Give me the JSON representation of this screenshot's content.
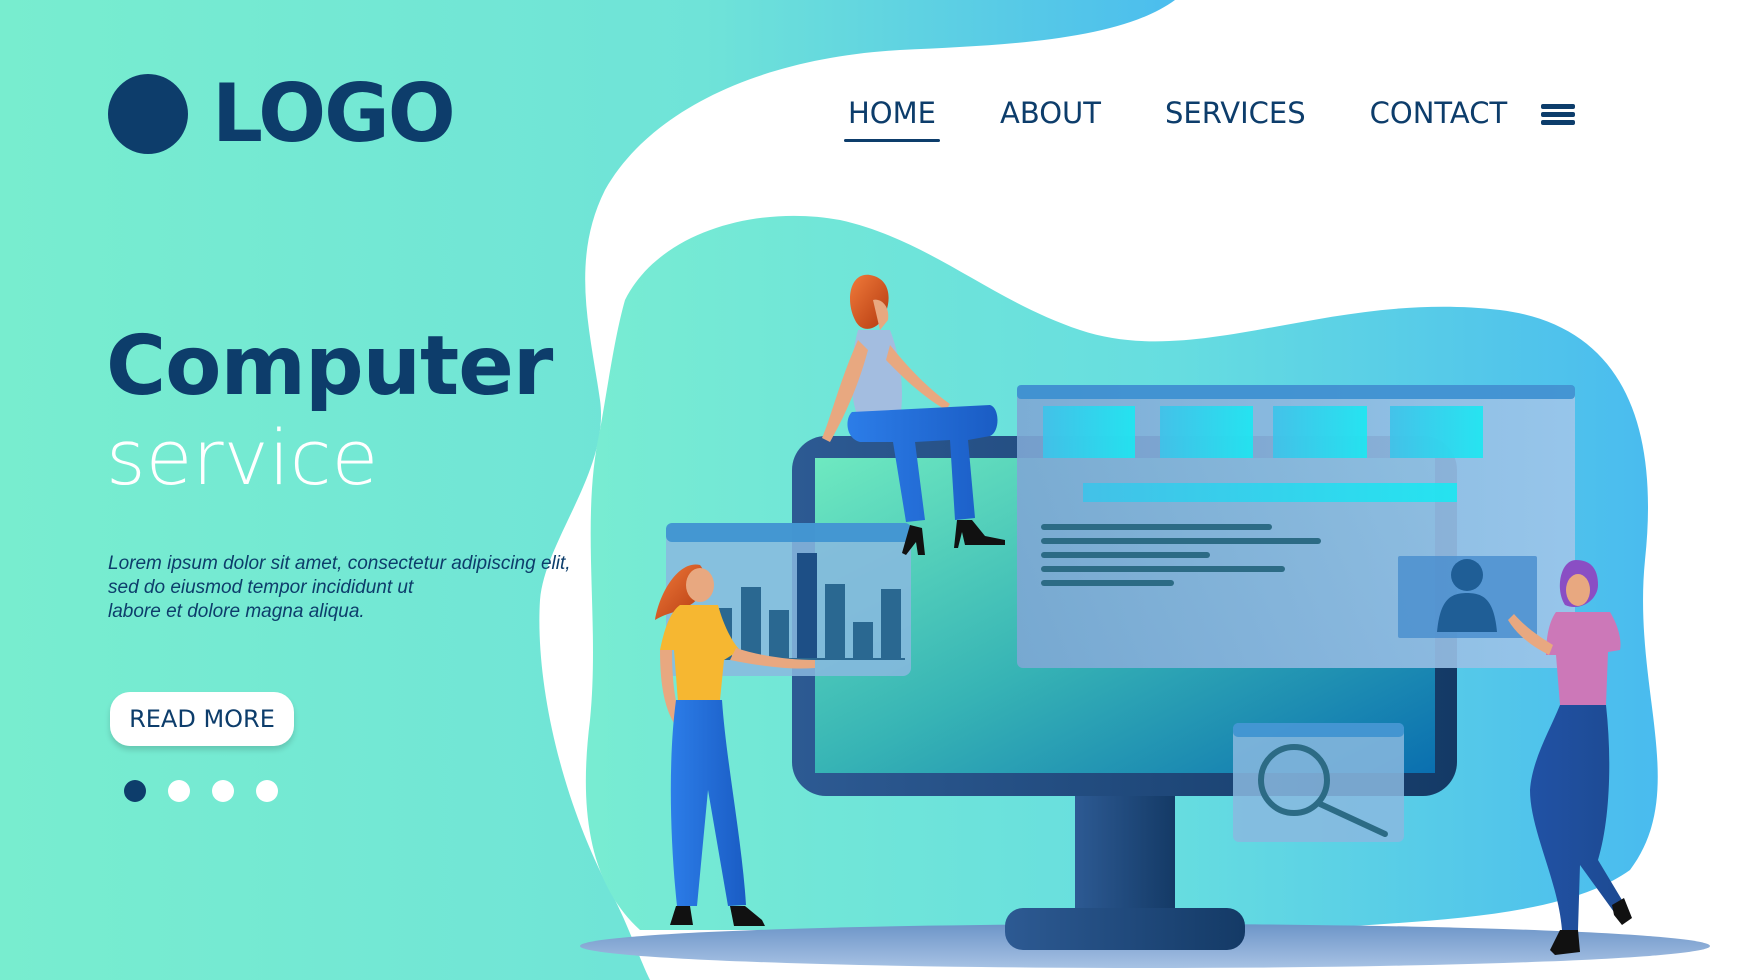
{
  "brand": {
    "logo_text": "LOGO",
    "primary_color": "#0d3d6b",
    "accent_teal": "#72ebd1",
    "accent_blue": "#4cbcec"
  },
  "nav": {
    "items": [
      {
        "label": "HOME",
        "active": true
      },
      {
        "label": "ABOUT",
        "active": false
      },
      {
        "label": "SERVICES",
        "active": false
      },
      {
        "label": "CONTACT",
        "active": false
      }
    ],
    "menu_icon": "hamburger-menu-icon"
  },
  "hero": {
    "title": "Computer",
    "subtitle": "service",
    "description_lines": [
      "Lorem ipsum dolor sit amet, consectetur adipiscing elit,",
      "sed do eiusmod tempor incididunt ut",
      "labore et dolore magna aliqua."
    ],
    "cta_label": "READ MORE"
  },
  "carousel": {
    "slide_count": 4,
    "active_index": 0
  },
  "illustration": {
    "icons": [
      "monitor-icon",
      "bar-chart-window-icon",
      "browser-window-icon",
      "user-profile-icon",
      "search-magnifier-icon"
    ],
    "people": [
      "woman-sitting-on-monitor",
      "woman-presenting-chart",
      "woman-waving"
    ]
  }
}
